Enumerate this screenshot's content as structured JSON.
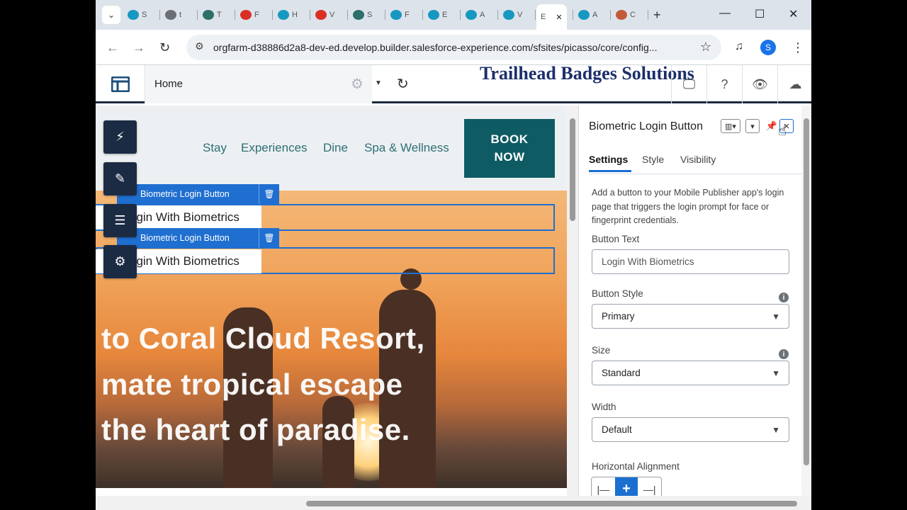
{
  "browser": {
    "tabs": [
      {
        "short": "S",
        "icon": "salesforce-cloud-icon",
        "color": "#1798c1"
      },
      {
        "short": "t",
        "icon": "globe-icon",
        "color": "#6b6f73"
      },
      {
        "short": "T",
        "icon": "trailhead-icon",
        "color": "#2d6f6a"
      },
      {
        "short": "F",
        "icon": "gmail-icon",
        "color": "#d93025"
      },
      {
        "short": "H",
        "icon": "salesforce-cloud-icon",
        "color": "#1798c1"
      },
      {
        "short": "V",
        "icon": "gmail-icon",
        "color": "#d93025"
      },
      {
        "short": "S",
        "icon": "trailhead-icon",
        "color": "#2d6f6a"
      },
      {
        "short": "F",
        "icon": "salesforce-cloud-icon",
        "color": "#1798c1"
      },
      {
        "short": "E",
        "icon": "salesforce-cloud-icon",
        "color": "#1798c1"
      },
      {
        "short": "A",
        "icon": "salesforce-cloud-icon",
        "color": "#1798c1"
      },
      {
        "short": "V",
        "icon": "salesforce-cloud-icon",
        "color": "#1798c1"
      },
      {
        "short": "E",
        "icon": "active-tab",
        "color": "#ffffff"
      },
      {
        "short": "A",
        "icon": "salesforce-cloud-icon",
        "color": "#1798c1"
      },
      {
        "short": "C",
        "icon": "astro-icon",
        "color": "#c25a3a"
      }
    ],
    "url": "orgfarm-d38886d2a8-dev-ed.develop.builder.salesforce-experience.com/sfsites/picasso/core/config...",
    "profile_initial": "S"
  },
  "builder": {
    "page": "Home",
    "overlay_title": "Trailhead Badges Solutions"
  },
  "site": {
    "nav": [
      "Stay",
      "Experiences",
      "Dine",
      "Spa & Wellness"
    ],
    "book_line1": "BOOK",
    "book_line2": "NOW",
    "hero_lines": [
      "to Coral Cloud Resort,",
      "mate tropical escape",
      "the heart of paradise."
    ],
    "components": [
      {
        "tag": "Biometric Login Button",
        "button": "ogin With Biometrics"
      },
      {
        "tag": "Biometric Login Button",
        "button": "ogin With Biometrics"
      }
    ]
  },
  "panel": {
    "title": "Biometric Login Button",
    "tabs": [
      "Settings",
      "Style",
      "Visibility"
    ],
    "description": "Add a button to your Mobile Publisher app's login page that triggers the login prompt for face or fingerprint credentials.",
    "button_text_label": "Button Text",
    "button_text_value": "Login With Biometrics",
    "button_style_label": "Button Style",
    "button_style_value": "Primary",
    "size_label": "Size",
    "size_value": "Standard",
    "width_label": "Width",
    "width_value": "Default",
    "halign_label": "Horizontal Alignment"
  }
}
